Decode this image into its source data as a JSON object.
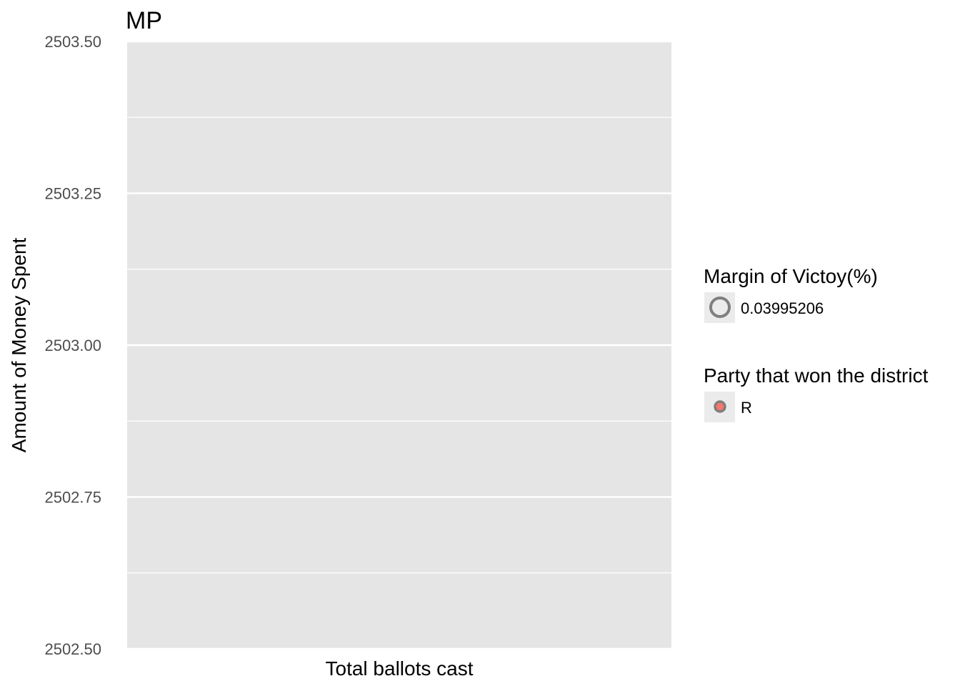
{
  "chart_data": {
    "type": "scatter",
    "title": "MP",
    "xlabel": "Total ballots cast",
    "ylabel": "Amount of Money Spent",
    "ylim": [
      2502.5,
      2503.5
    ],
    "y_ticks": [
      "2503.50",
      "2503.25",
      "2503.00",
      "2502.75",
      "2502.50"
    ],
    "y_tick_values": [
      2503.5,
      2503.25,
      2503.0,
      2502.75,
      2502.5
    ],
    "grid": true,
    "points": [],
    "legend_position": "right",
    "legends": [
      {
        "title": "Margin of Victoy(%)",
        "entries": [
          {
            "label": "0.03995206",
            "marker": "open-circle",
            "color": "#7f7f7f"
          }
        ]
      },
      {
        "title": "Party that won the district",
        "entries": [
          {
            "label": "R",
            "marker": "filled-circle",
            "color": "#f8766d"
          }
        ]
      }
    ],
    "colors": {
      "panel": "#e5e5e5",
      "grid": "#ffffff",
      "legend_key_bg": "#ebebeb",
      "marker_outline": "#7f7f7f"
    }
  }
}
